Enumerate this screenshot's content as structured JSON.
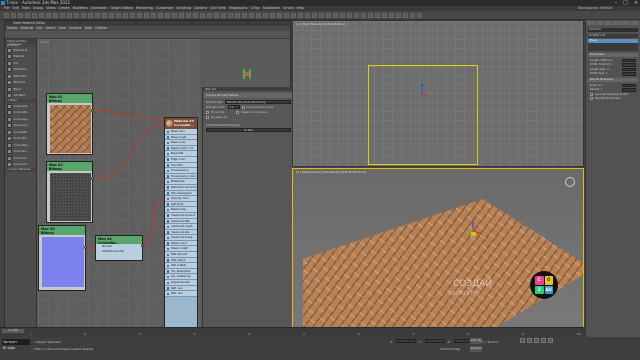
{
  "app": {
    "title": "T.max - Autodesk 3ds Max 2022",
    "menus": [
      "File",
      "Edit",
      "Tools",
      "Group",
      "Views",
      "Create",
      "Modifiers",
      "Animation",
      "Graph Editors",
      "Rendering",
      "Customize",
      "Scripting",
      "Content",
      "Civil View",
      "Megascans",
      "V-Ray",
      "Substance",
      "Arnold",
      "Help"
    ],
    "workspace": "Workspaces: Default"
  },
  "slate": {
    "title": "Slate Material Editor",
    "menu": "Modes Material Edit Select View Options Tools Utilities",
    "view_label": "View1",
    "browser_header": "Material/Map Browser",
    "browser_sections": [
      "+ Materials",
      "+ Maps",
      "+ Scene Materials"
    ],
    "browser_items": [
      "Physical M...",
      "Material ...",
      "Mix",
      "Multi/Sub...",
      "Shell Mat...",
      "Standard",
      "Blend",
      "Car Paint",
      "Composite",
      "CoronaMix",
      "CoronaLay...",
      "CoronaLig...",
      "CoronaMtl",
      "CoronaPh...",
      "CoronaRay...",
      "CoronaSc...",
      "CoronaSh...",
      "CoronaVol..."
    ],
    "nodes": [
      {
        "title": "Map #1",
        "subtitle": "Bitmap"
      },
      {
        "title": "Map #2",
        "subtitle": "Bitmap"
      },
      {
        "title": "Map #3",
        "subtitle": "Bitmap"
      },
      {
        "title": "Map #4",
        "subtitle": "CoronaNo..."
      }
    ],
    "bump_slots": [
      "Normal",
      "Additional bump"
    ],
    "material": {
      "title": "Material #4",
      "type": "CoronaPh...",
      "slots": [
        "Base color",
        "Base rough",
        "Base aniso",
        "Base anisotr. rot",
        "Base IOR",
        "Edge color",
        "Thin film",
        "Translucency fraction",
        "Translucency color",
        "Metalness",
        "Refraction amount",
        "Thin absorption",
        "Opacity color",
        "Self-illum",
        "Base bump",
        "Clearcoat amount",
        "Clearcoat IOR",
        "Clearcoat rough",
        "Clearcoat abs.",
        "Clearcoat bump",
        "Sheen color",
        "Sheen rough",
        "SSS amount",
        "SSS radius",
        "SSS scatter",
        "Vol. absorption",
        "Vol. scattering",
        "Displacement",
        "Refl. env",
        "Refr. env"
      ]
    },
    "params": {
      "header": "Map #4",
      "rollout": "Corona Normal Texture",
      "normal_map_label": "Normal map:",
      "normal_map_value": "Map #3 (100_wk_Bx_Normal.png)",
      "strength_label": "Strength mult.:",
      "strength_value": "1.0",
      "add_gamma_label": "Add gamma to input",
      "flip_label": "Flip green (Y)",
      "swap_label": "Swap red and green",
      "fix_label": "Fix red (X)",
      "fix_green_label": "Fix green (Y)",
      "additional_label": "Additional Bump Mapping",
      "additional_value": "No Map",
      "status": "Rendering finished"
    }
  },
  "viewports": {
    "top_label": "[+] [Top] [Standard] [Wireframe]",
    "persp_label": "[+] [Perspective] [Standard] [Default Shading]",
    "watermark": "СОЗДАЙ",
    "watermark_sub": "СВОЮ ИГРУ",
    "badge_letters": [
      "C",
      "O",
      "3",
      "AU"
    ]
  },
  "command_panel": {
    "object_name": "Plane001",
    "modifier_list": "Modifier List",
    "stack_item": "Plane",
    "section_params": "Parameters",
    "rows": [
      "Length: 1000.0cm",
      "Width: 1000.0cm",
      "Length Segs: 4",
      "Width Segs: 4"
    ],
    "section_render": "Render Multipliers",
    "render_rows": [
      "Scale: 1.0",
      "Density: 1"
    ],
    "gen_coords": "Generate Mapping Coords.",
    "real_world": "Real-World Map Size"
  },
  "timeline": {
    "slider": "0 / 100",
    "ticks": [
      "0",
      "10",
      "20",
      "30",
      "40",
      "50",
      "60",
      "70",
      "80",
      "90",
      "100"
    ]
  },
  "status": {
    "maxscript": "Sprayer Bridge",
    "message": "1 Object Selected",
    "hint": "Click or click-and-drag to select objects",
    "x_label": "X:",
    "y_label": "Y:",
    "z_label": "Z:",
    "grid": "Grid = 10.0cm",
    "add_time_tag": "Add Time Tag",
    "auto_key": "Auto Key",
    "selected": "Selected"
  },
  "colors": {
    "node_header": "#58a66c",
    "material_header": "#7a4f3c",
    "wire": "#c0392b",
    "port": "#f0e820",
    "selection": "#d8d000"
  }
}
